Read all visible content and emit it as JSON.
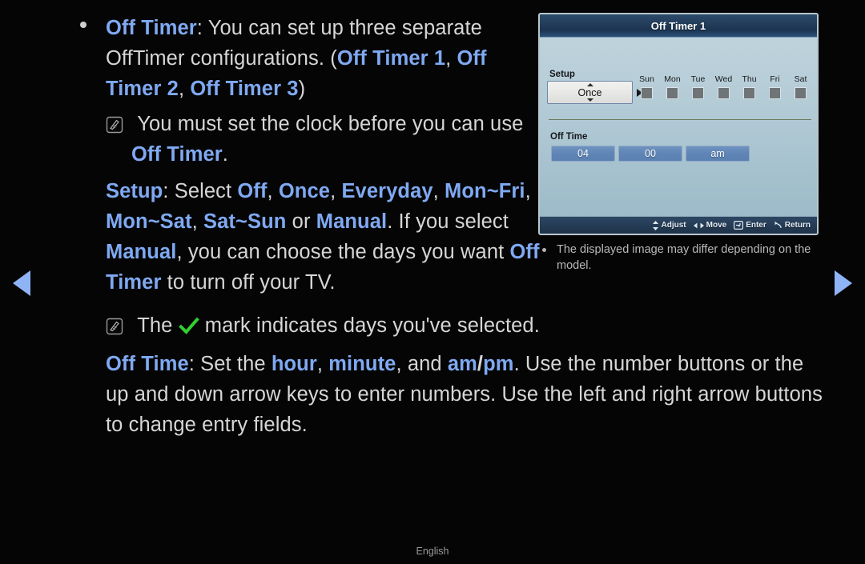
{
  "page": {
    "language_footer": "English",
    "accent_blue": "#7fa9f2",
    "body_text_color": "#d6d6d6",
    "background": "#050505",
    "nav_arrow_color": "#8fb4f6",
    "check_color": "#32c832"
  },
  "nav": {
    "prev_label": "Previous page",
    "next_label": "Next page"
  },
  "body_text": {
    "bullet1": {
      "term": "Off Timer",
      "line1_rest": ": You can set up three separate Off",
      "line2_pre": "Timer configurations. (",
      "opt1": "Off Timer 1",
      "sep1": ", ",
      "opt2": "Off Timer 2",
      "sep2": ", ",
      "opt3": "Off Timer 3",
      "close": ")"
    },
    "note1": {
      "icon": "note-icon",
      "line1": "You must set the clock before you can use",
      "line2_term": "Off Timer",
      "line2_rest": "."
    },
    "setup_para": {
      "term": "Setup",
      "t1": ": Select ",
      "o1": "Off",
      "t2": ", ",
      "o2": "Once",
      "t3": ", ",
      "o3": "Everyday",
      "t4": ",",
      "o4": "Mon~Fri",
      "t5": ", ",
      "o5": "Mon~Sat",
      "t6": ", ",
      "o6": "Sat~Sun",
      "t7": " or ",
      "o7": "Manual",
      "t8": ". If",
      "l3_pre": "you select ",
      "o8": "Manual",
      "l3_post": ", you can choose the days",
      "l4_pre": "you want ",
      "o9": "Off Timer",
      "l4_post": " to turn off your TV."
    },
    "note2": {
      "icon": "note-icon",
      "pre": "The ",
      "check": "check-icon",
      "post": " mark indicates days you've selected."
    },
    "offtime_para": {
      "term": "Off Time",
      "t1": ": Set the ",
      "o1": "hour",
      "t2": ", ",
      "o2": "minute",
      "t3": ", and ",
      "o3": "am",
      "t4": "/",
      "o4": "pm",
      "t5": ". Use the number buttons or the",
      "line2": "up and down arrow keys to enter numbers. Use the left and right arrow buttons",
      "line3": "to change entry fields."
    }
  },
  "osd": {
    "title": "Off Timer 1",
    "setup_label": "Setup",
    "setup_value": "Once",
    "days": [
      {
        "name": "Sun",
        "checked": false
      },
      {
        "name": "Mon",
        "checked": false
      },
      {
        "name": "Tue",
        "checked": false
      },
      {
        "name": "Wed",
        "checked": false
      },
      {
        "name": "Thu",
        "checked": false
      },
      {
        "name": "Fri",
        "checked": false
      },
      {
        "name": "Sat",
        "checked": false
      }
    ],
    "offtime_label": "Off Time",
    "time": {
      "hour": "04",
      "minute": "00",
      "meridiem": "am"
    },
    "footer_hints": [
      {
        "icon": "updown-arrow-icon",
        "label": "Adjust"
      },
      {
        "icon": "leftright-arrow-icon",
        "label": "Move"
      },
      {
        "icon": "enter-icon",
        "label": "Enter"
      },
      {
        "icon": "return-icon",
        "label": "Return"
      }
    ]
  },
  "caption": {
    "text": "The displayed image may differ depending on the model."
  }
}
